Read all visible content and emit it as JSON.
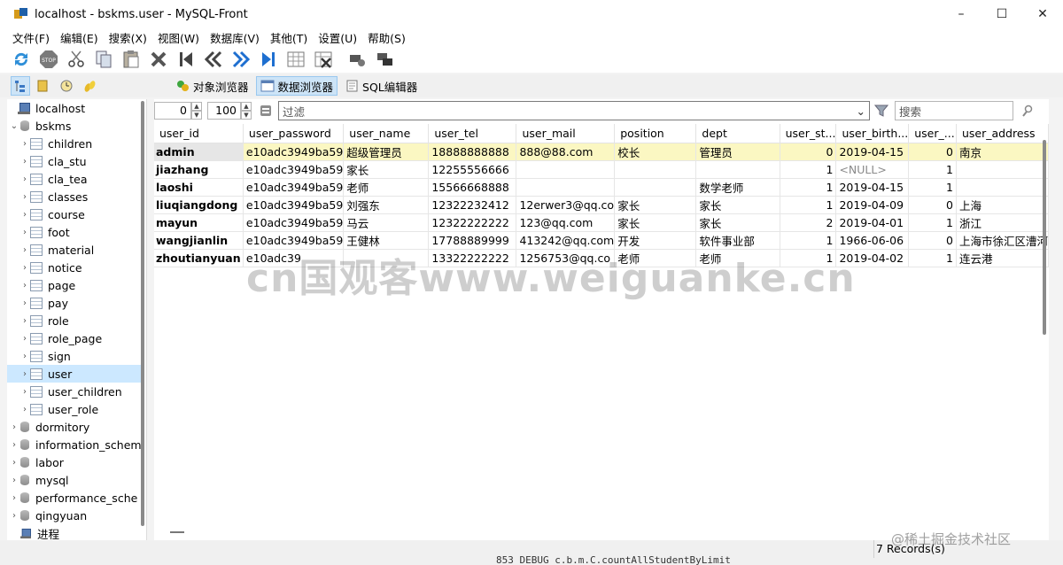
{
  "window": {
    "title": "localhost - bskms.user - MySQL-Front"
  },
  "menu": [
    "文件(F)",
    "编辑(E)",
    "搜索(X)",
    "视图(W)",
    "数据库(V)",
    "其他(T)",
    "设置(U)",
    "帮助(S)"
  ],
  "viewbar": {
    "object_browser": "对象浏览器",
    "data_browser": "数据浏览器",
    "sql_editor": "SQL编辑器"
  },
  "tree": {
    "host": "localhost",
    "db_open": "bskms",
    "tables": [
      "children",
      "cla_stu",
      "cla_tea",
      "classes",
      "course",
      "foot",
      "material",
      "notice",
      "page",
      "pay",
      "role",
      "role_page",
      "sign",
      "user",
      "user_children",
      "user_role"
    ],
    "selected": "user",
    "databases": [
      "dormitory",
      "information_schem",
      "labor",
      "mysql",
      "performance_sche",
      "qingyuan"
    ],
    "process": "进程"
  },
  "filterbar": {
    "offset": "0",
    "limit": "100",
    "filter_placeholder": "过滤",
    "search_placeholder": "搜索"
  },
  "columns": [
    "user_id",
    "user_password",
    "user_name",
    "user_tel",
    "user_mail",
    "position",
    "dept",
    "user_st...",
    "user_birth...",
    "user_...",
    "user_address"
  ],
  "rows": [
    {
      "user_id": "admin",
      "password": "e10adc3949ba59",
      "name": "超级管理员",
      "tel": "18888888888",
      "mail": "888@88.com",
      "position": "校长",
      "dept": "管理员",
      "st": "0",
      "birth": "2019-04-15",
      "u": "0",
      "address": "南京"
    },
    {
      "user_id": "jiazhang",
      "password": "e10adc3949ba59",
      "name": "家长",
      "tel": "12255556666",
      "mail": "",
      "position": "",
      "dept": "",
      "st": "1",
      "birth": "<NULL>",
      "u": "1",
      "address": ""
    },
    {
      "user_id": "laoshi",
      "password": "e10adc3949ba59",
      "name": "老师",
      "tel": "15566668888",
      "mail": "",
      "position": "",
      "dept": "数学老师",
      "st": "1",
      "birth": "2019-04-15",
      "u": "1",
      "address": ""
    },
    {
      "user_id": "liuqiangdong",
      "password": "e10adc3949ba59",
      "name": "刘强东",
      "tel": "12322232412",
      "mail": "12erwer3@qq.co",
      "position": "家长",
      "dept": "家长",
      "st": "1",
      "birth": "2019-04-09",
      "u": "0",
      "address": "上海"
    },
    {
      "user_id": "mayun",
      "password": "e10adc3949ba59",
      "name": "马云",
      "tel": "12322222222",
      "mail": "123@qq.com",
      "position": "家长",
      "dept": "家长",
      "st": "2",
      "birth": "2019-04-01",
      "u": "1",
      "address": "浙江"
    },
    {
      "user_id": "wangjianlin",
      "password": "e10adc3949ba59",
      "name": "王健林",
      "tel": "17788889999",
      "mail": "413242@qq.com",
      "position": "开发",
      "dept": "软件事业部",
      "st": "1",
      "birth": "1966-06-06",
      "u": "0",
      "address": "上海市徐汇区漕河"
    },
    {
      "user_id": "zhoutianyuan",
      "password": "e10adc39",
      "name": "",
      "tel": "13322222222",
      "mail": "1256753@qq.co",
      "position": "老师",
      "dept": "老师",
      "st": "1",
      "birth": "2019-04-02",
      "u": "1",
      "address": "连云港"
    }
  ],
  "watermark": "cn国观客www.weiguanke.cn",
  "status": {
    "records": "7 Records(s)",
    "juejin": "@稀土掘金技术社区"
  },
  "bottom_strip": "853 DEBUG c.b.m.C.countAllStudentByLimit"
}
